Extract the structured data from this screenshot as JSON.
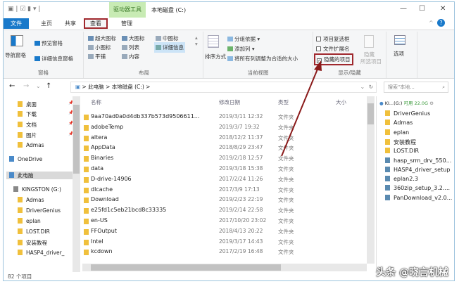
{
  "window": {
    "title": "本地磁盘 (C:)",
    "context_tab": "驱动器工具"
  },
  "tabs": [
    {
      "label": "文件"
    },
    {
      "label": "主页"
    },
    {
      "label": "共享"
    },
    {
      "label": "查看",
      "selected": true
    },
    {
      "label": "管理"
    }
  ],
  "ribbon": {
    "panes": {
      "label": "窗格",
      "nav_pane": "导航窗格",
      "preview_pane": "预览窗格",
      "details_pane": "详细信息窗格"
    },
    "layout": {
      "label": "布局",
      "items": [
        "超大图标",
        "大图标",
        "中图标",
        "小图标",
        "列表",
        "详细信息",
        "平铺",
        "内容"
      ],
      "selected": "详细信息"
    },
    "current_view": {
      "label": "当前视图",
      "sort": "排序方式",
      "group_by": "分组依据 ▾",
      "add_column": "添加列 ▾",
      "fit_columns": "将所有列调整为合适的大小"
    },
    "show_hide": {
      "label": "显示/隐藏",
      "item_checkboxes": "项目复选框",
      "file_extensions": "文件扩展名",
      "hidden_items": "隐藏的项目",
      "hide_selected": "隐藏",
      "hide_selected2": "所选项目",
      "item_checkboxes_checked": false,
      "file_extensions_checked": false,
      "hidden_items_checked": true
    },
    "options": {
      "label": "选项"
    }
  },
  "address": {
    "crumbs": [
      "此电脑",
      "本地磁盘 (C:)"
    ],
    "search_placeholder": "搜索\"本地...",
    "sep": ">"
  },
  "nav": {
    "items": [
      {
        "label": "桌面",
        "pinned": true
      },
      {
        "label": "下载",
        "pinned": true
      },
      {
        "label": "文档",
        "pinned": true
      },
      {
        "label": "图片",
        "pinned": true
      },
      {
        "label": "Admas"
      },
      {
        "label": "OneDrive"
      },
      {
        "label": "此电脑"
      },
      {
        "label": "KINGSTON (G:)"
      },
      {
        "label": "Admas"
      },
      {
        "label": "DriverGenius"
      },
      {
        "label": "eplan"
      },
      {
        "label": "LOST.DIR"
      },
      {
        "label": "安装教程"
      },
      {
        "label": "HASP4_driver_"
      }
    ]
  },
  "columns": {
    "name": "名称",
    "date": "修改日期",
    "type": "类型",
    "size": "大小"
  },
  "files": [
    {
      "name": "9aa70ad0a0d4db337b573d9506611...",
      "date": "2019/3/11 12:32",
      "type": "文件夹"
    },
    {
      "name": "adobeTemp",
      "date": "2019/3/7 19:32",
      "type": "文件夹"
    },
    {
      "name": "altera",
      "date": "2018/12/2 11:37",
      "type": "文件夹"
    },
    {
      "name": "AppData",
      "date": "2018/8/29 23:47",
      "type": "文件夹"
    },
    {
      "name": "Binaries",
      "date": "2019/2/18 12:57",
      "type": "文件夹"
    },
    {
      "name": "data",
      "date": "2019/3/18 15:38",
      "type": "文件夹"
    },
    {
      "name": "D-drive-14906",
      "date": "2017/2/24 11:26",
      "type": "文件夹"
    },
    {
      "name": "dlcache",
      "date": "2017/3/9 17:13",
      "type": "文件夹"
    },
    {
      "name": "Download",
      "date": "2019/2/23 22:19",
      "type": "文件夹"
    },
    {
      "name": "e25fd1c5eb21bcd8c33335",
      "date": "2019/2/14 22:58",
      "type": "文件夹"
    },
    {
      "name": "en-US",
      "date": "2017/10/20 23:02",
      "type": "文件夹"
    },
    {
      "name": "FFOutput",
      "date": "2018/4/13 20:22",
      "type": "文件夹"
    },
    {
      "name": "Intel",
      "date": "2019/3/17 14:43",
      "type": "文件夹"
    },
    {
      "name": "kcdown",
      "date": "2017/2/19 16:48",
      "type": "文件夹"
    }
  ],
  "preview": {
    "drive": "KI...(G:)",
    "free": "可用 22.0G",
    "items": [
      "DriverGenius",
      "Admas",
      "eplan",
      "安装教程",
      "LOST.DIR",
      "hasp_srm_drv_550...",
      "HASP4_driver_setup",
      "eplan2.3",
      "360zip_setup_3.2....",
      "PanDownload_v2.0..."
    ]
  },
  "status": {
    "count": "82 个项目"
  },
  "watermark": "头条 @晓言机械",
  "colors": {
    "accent": "#1979ca",
    "highlight": "#a0282d",
    "context_tab": "#c8ebb4"
  }
}
